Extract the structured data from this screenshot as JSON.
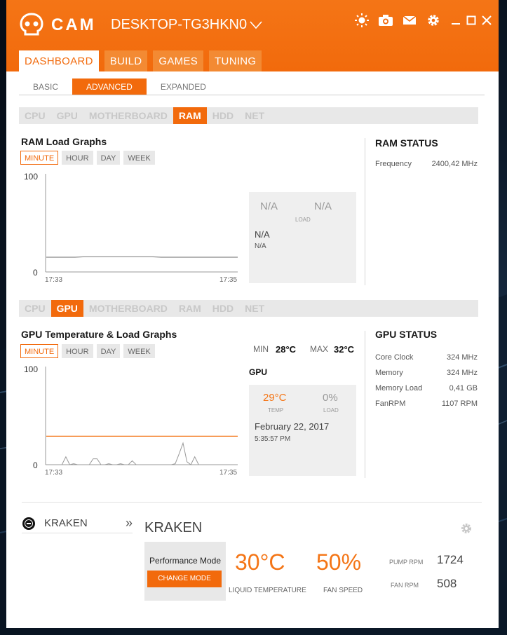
{
  "app": {
    "title": "CAM",
    "device": "DESKTOP-TG3HKN0",
    "accent": "#f26a0c"
  },
  "header_icons": [
    "brightness-icon",
    "camera-icon",
    "mail-icon",
    "gear-icon"
  ],
  "main_tabs": [
    "DASHBOARD",
    "BUILD",
    "GAMES",
    "TUNING"
  ],
  "sub_tabs": [
    "BASIC",
    "ADVANCED",
    "EXPANDED"
  ],
  "ram_components": [
    "CPU",
    "GPU",
    "MOTHERBOARD",
    "RAM",
    "HDD",
    "NET"
  ],
  "ram_section": {
    "title": "RAM Load Graphs",
    "ranges": [
      "MINUTE",
      "HOUR",
      "DAY",
      "WEEK"
    ],
    "y_max": "100",
    "y_min": "0",
    "t_start": "17:33",
    "t_end": "17:35",
    "load_level": 15,
    "box": {
      "val1": "N/A",
      "val2": "N/A",
      "label": "LOAD",
      "line1": "N/A",
      "line2": "N/A"
    },
    "status_title": "RAM STATUS",
    "status": [
      {
        "label": "Frequency",
        "value": "2400,42 MHz"
      }
    ]
  },
  "gpu_components": [
    "CPU",
    "GPU",
    "MOTHERBOARD",
    "RAM",
    "HDD",
    "NET"
  ],
  "gpu_section": {
    "title": "GPU Temperature & Load Graphs",
    "ranges": [
      "MINUTE",
      "HOUR",
      "DAY",
      "WEEK"
    ],
    "min_label": "MIN",
    "min_value": "28°C",
    "max_label": "MAX",
    "max_value": "32°C",
    "y_max": "100",
    "y_min": "0",
    "t_start": "17:33",
    "t_end": "17:35",
    "temp_level": 29,
    "load_series": [
      0,
      0,
      0,
      0,
      0,
      8,
      0,
      1,
      0,
      0,
      0,
      0,
      6,
      6,
      0,
      0,
      1,
      0,
      0,
      1,
      0,
      0,
      4,
      0,
      0,
      0,
      0,
      0,
      0,
      0,
      0,
      0,
      0,
      1,
      11,
      22,
      3,
      0,
      8,
      0,
      0,
      0,
      0,
      0,
      0,
      0,
      0,
      0,
      0,
      0
    ],
    "box_title": "GPU",
    "temp": "29°C",
    "temp_label": "TEMP",
    "load": "0%",
    "load_label": "LOAD",
    "date": "February 22, 2017",
    "time": "5:35:57 PM",
    "status_title": "GPU STATUS",
    "status": [
      {
        "label": "Core Clock",
        "value": "324 MHz"
      },
      {
        "label": "Memory",
        "value": "324 MHz"
      },
      {
        "label": "Memory Load",
        "value": "0,41 GB"
      },
      {
        "label": "FanRPM",
        "value": "1107 RPM"
      }
    ]
  },
  "kraken": {
    "nav_label": "KRAKEN",
    "nav_arrow": "»",
    "title": "KRAKEN",
    "mode": "Performance Mode",
    "change_mode": "CHANGE MODE",
    "liquid_temp": "30°C",
    "liquid_temp_label": "LIQUID TEMPERATURE",
    "fan_speed": "50%",
    "fan_speed_label": "FAN SPEED",
    "pump_label": "PUMP RPM",
    "pump_value": "1724",
    "fan_label": "FAN RPM",
    "fan_value": "508"
  }
}
